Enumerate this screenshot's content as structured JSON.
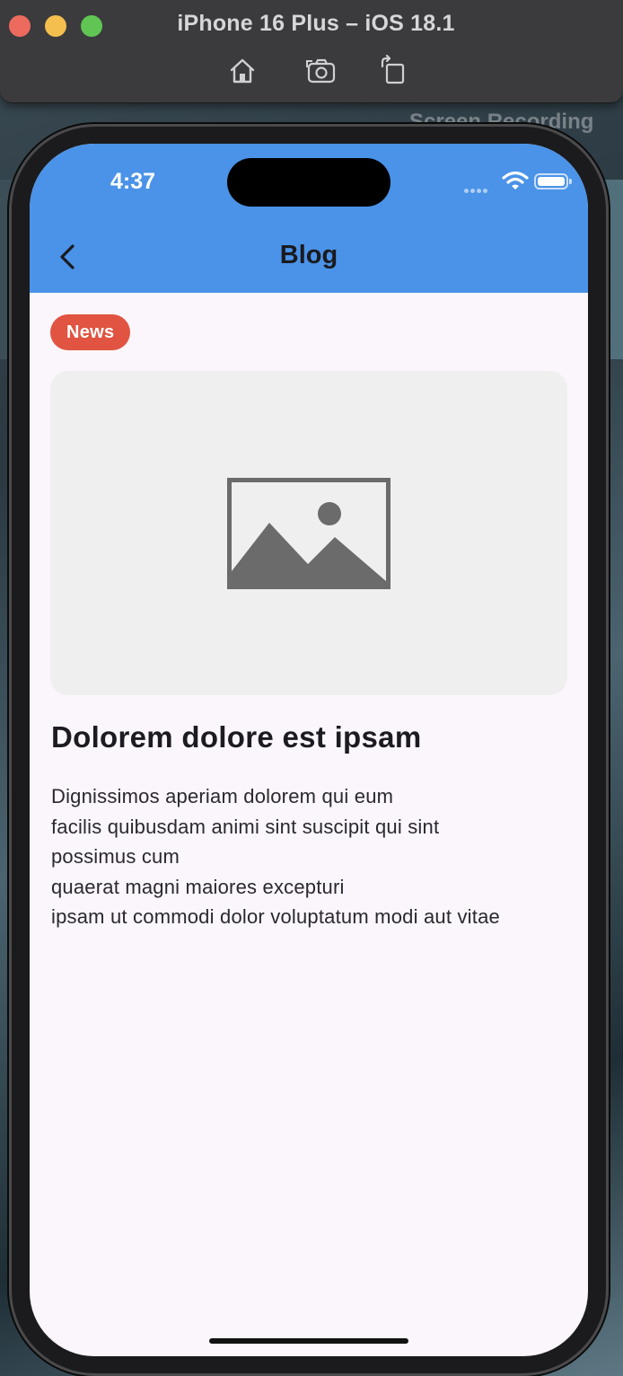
{
  "simulator": {
    "title": "iPhone 16 Plus – iOS 18.1",
    "tools": [
      "home-icon",
      "screenshot-icon",
      "rotate-icon"
    ],
    "overlay_text": "Screen Recording\n…ov"
  },
  "status_bar": {
    "time": "4:37"
  },
  "app_bar": {
    "title": "Blog",
    "back_icon": "chevron-left-icon",
    "color": "#4a93e8"
  },
  "post": {
    "category": "News",
    "category_color": "#e05441",
    "image_icon": "image-placeholder-icon",
    "title": "Dolorem dolore est ipsam",
    "body_lines": [
      "Dignissimos aperiam dolorem qui eum",
      "facilis quibusdam animi sint suscipit qui sint",
      "possimus cum",
      "quaerat magni maiores excepturi",
      "ipsam ut commodi dolor voluptatum modi aut vitae"
    ]
  }
}
